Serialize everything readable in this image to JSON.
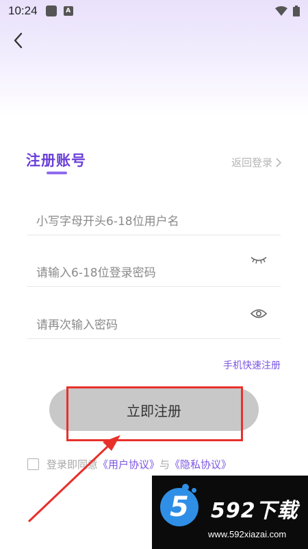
{
  "status_bar": {
    "time": "10:24",
    "a_badge": "A"
  },
  "header": {
    "back_icon": "chevron-left-icon"
  },
  "form": {
    "title": "注册账号",
    "back_to_login": "返回登录",
    "username_placeholder": "小写字母开头6-18位用户名",
    "password_placeholder": "请输入6-18位登录密码",
    "confirm_placeholder": "请再次输入密码",
    "phone_register": "手机快速注册",
    "submit_label": "立即注册"
  },
  "agreement": {
    "prefix": "登录即同意",
    "user_agreement": "《用户协议》",
    "conjunction": "与",
    "privacy_policy": "《隐私协议》"
  },
  "watermark": {
    "brand": "592下载",
    "url": "www.592xiazai.com",
    "logo_digit": "5"
  },
  "colors": {
    "accent": "#6a3fd8",
    "link": "#7b56e2",
    "button": "#c8c8c8",
    "annotation": "#e8302b"
  }
}
